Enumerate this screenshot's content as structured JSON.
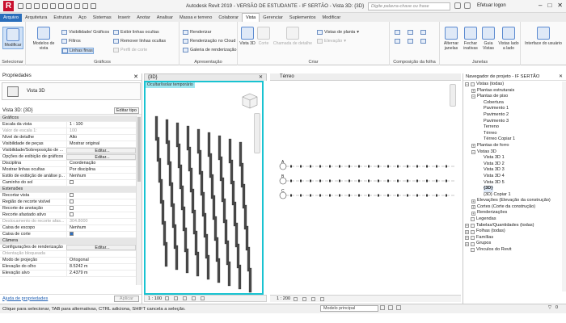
{
  "titlebar": {
    "app_initial": "R",
    "title": "Autodesk Revit 2019 - VERSÃO DE ESTUDANTE - IF SERTÃO - Vista 3D: {3D}",
    "search_placeholder": "Digite palavra-chave ou frase",
    "user": "Efetuar logon"
  },
  "tabs": [
    "Arquivo",
    "Arquitetura",
    "Estrutura",
    "Aço",
    "Sistemas",
    "Inserir",
    "Anotar",
    "Analisar",
    "Massa e terreno",
    "Colaborar",
    "Vista",
    "Gerenciar",
    "Suplementos",
    "Modificar"
  ],
  "active_tab": "Vista",
  "ribbon": {
    "modify_label": "Modificar",
    "selection_group": "Selecionar",
    "view_template_label": "Modelos de vista",
    "graphics": {
      "vis_graphics": "Visibilidade/ Gráficos",
      "filters": "Filtros",
      "thin_lines": "Linhas finas",
      "show_hidden": "Exibir linhas ocultas",
      "remove_hidden": "Remover linhas ocultas",
      "cut_profile": "Perfil de corte",
      "group_title": "Gráficos"
    },
    "presentation": {
      "render": "Renderizar",
      "render_cloud": "Renderização no Cloud",
      "render_gallery": "Galeria de renderização",
      "group_title": "Apresentação"
    },
    "create": {
      "view3d": "Vista 3D",
      "section": "Corte",
      "callout": "Chamada de detalhe",
      "plan_views": "Vistas de planta",
      "elevation": "Elevação",
      "group_title": "Criar"
    },
    "sheet_composition": {
      "group_title": "Composição da folha"
    },
    "windows": {
      "switch": "Alternar janelas",
      "close": "Fechar inativas",
      "tile": "Guia Vistas",
      "side": "Vistas lado a lado",
      "group_title": "Janelas"
    },
    "ui": {
      "label": "Interface do usuário"
    }
  },
  "properties": {
    "title": "Propriedades",
    "type_name": "Vista 3D",
    "type_filter": "Vista 3D: {3D}",
    "edit_type": "Editar tipo",
    "rows": [
      {
        "group": "Gráficos"
      },
      {
        "k": "Escala da vista",
        "v": "1 : 100"
      },
      {
        "k": "Valor de escala    1:",
        "v": "100",
        "dim": true
      },
      {
        "k": "Nível de detalhe",
        "v": "Alto"
      },
      {
        "k": "Visibilidade de peças",
        "v": "Mostrar original"
      },
      {
        "k": "Visibilidade/Sobreposição de ...",
        "v": "Editar...",
        "btn": true
      },
      {
        "k": "Opções de exibição de gráficos",
        "v": "Editar...",
        "btn": true
      },
      {
        "k": "Disciplina",
        "v": "Coordenação"
      },
      {
        "k": "Mostrar linhas ocultas",
        "v": "Por disciplina"
      },
      {
        "k": "Estilo de exibição de análise p...",
        "v": "Nenhum"
      },
      {
        "k": "Caminho do sol",
        "chk": false
      },
      {
        "group": "Extensões"
      },
      {
        "k": "Recortar vista",
        "chk": false
      },
      {
        "k": "Região de recorte visível",
        "chk": false
      },
      {
        "k": "Recorte de anotação",
        "chk": false
      },
      {
        "k": "Recorte afastado ativo",
        "chk": false
      },
      {
        "k": "Deslocamento do recorte afas...",
        "v": "304.8000",
        "dim": true
      },
      {
        "k": "Caixa de escopo",
        "v": "Nenhum"
      },
      {
        "k": "Caixa de corte",
        "chk": true
      },
      {
        "group": "Câmera"
      },
      {
        "k": "Configurações de renderização",
        "v": "Editar...",
        "btn": true
      },
      {
        "k": "Orientação bloqueada",
        "v": "",
        "dim": true
      },
      {
        "k": "Modo de projeção",
        "v": "Ortogonal"
      },
      {
        "k": "Elevação do olho",
        "v": "8.5242 m"
      },
      {
        "k": "Elevação alvo",
        "v": "2.4379 m"
      }
    ],
    "help_link": "Ajuda de propriedades",
    "apply": "Aplicar"
  },
  "view3d": {
    "tab": "{3D}",
    "temp_badge": "Ocultar/isolar temporário",
    "scale": "1 : 100"
  },
  "terreo": {
    "tab": "Térreo",
    "scale": "1 : 200",
    "grid_labels": [
      "A",
      "B",
      "C"
    ]
  },
  "navigator": {
    "title": "Navegador de projeto - IF SERTÃO",
    "items": [
      {
        "label": "Vistas (todas)",
        "level": 0,
        "toggle": "-",
        "icon": true
      },
      {
        "label": "Plantas estruturais",
        "level": 1,
        "toggle": "+"
      },
      {
        "label": "Plantas de piso",
        "level": 1,
        "toggle": "-"
      },
      {
        "label": "Cobertura",
        "level": 2
      },
      {
        "label": "Pavimento 1",
        "level": 2
      },
      {
        "label": "Pavimento 2",
        "level": 2
      },
      {
        "label": "Pavimento 3",
        "level": 2
      },
      {
        "label": "Terreno",
        "level": 2
      },
      {
        "label": "Térreo",
        "level": 2
      },
      {
        "label": "Térreo Copiar 1",
        "level": 2
      },
      {
        "label": "Plantas de forro",
        "level": 1,
        "toggle": "+"
      },
      {
        "label": "Vistas 3D",
        "level": 1,
        "toggle": "-"
      },
      {
        "label": "Vista 3D 1",
        "level": 2
      },
      {
        "label": "Vista 3D 2",
        "level": 2
      },
      {
        "label": "Vista 3D 3",
        "level": 2
      },
      {
        "label": "Vista 3D 4",
        "level": 2
      },
      {
        "label": "Vista 3D 5",
        "level": 2
      },
      {
        "label": "{3D}",
        "level": 2,
        "selected": true
      },
      {
        "label": "{3D} Copiar 1",
        "level": 2
      },
      {
        "label": "Elevações (Elevação da construção)",
        "level": 1,
        "toggle": "+"
      },
      {
        "label": "Cortes (Corte da construção)",
        "level": 1,
        "toggle": "+"
      },
      {
        "label": "Renderizações",
        "level": 1,
        "toggle": "+"
      },
      {
        "label": "Legendas",
        "level": 0,
        "icon": true
      },
      {
        "label": "Tabelas/Quantidades (todas)",
        "level": 0,
        "toggle": "+",
        "icon": true
      },
      {
        "label": "Folhas (todas)",
        "level": 0,
        "toggle": "+",
        "icon": true
      },
      {
        "label": "Famílias",
        "level": 0,
        "toggle": "+",
        "icon": true
      },
      {
        "label": "Grupos",
        "level": 0,
        "toggle": "+",
        "icon": true
      },
      {
        "label": "Vínculos do Revit",
        "level": 0,
        "icon": true
      }
    ]
  },
  "statusbar": {
    "hint": "Clique para selecionar, TAB para alternativas, CTRL adiciona, SHIFT cancela a seleção.",
    "model": "Modelo principal",
    "right_value": "0"
  },
  "colors": {
    "accent": "#2a6ebb",
    "view_highlight": "#19c3d1",
    "brand": "#c8102e"
  }
}
